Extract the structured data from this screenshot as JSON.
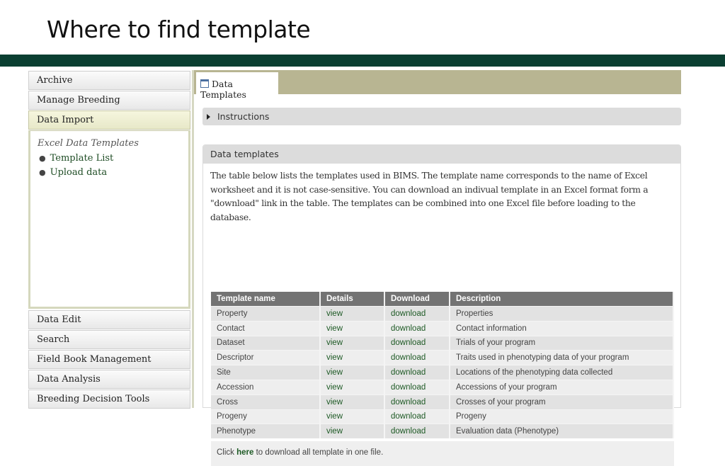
{
  "slide": {
    "title": "Where to find template"
  },
  "sidebar": {
    "items_top": [
      {
        "label": "Archive"
      },
      {
        "label": "Manage Breeding"
      },
      {
        "label": "Data Import",
        "active": true
      }
    ],
    "submenu": {
      "heading": "Excel Data Templates",
      "links": [
        {
          "label": "Template List"
        },
        {
          "label": "Upload data"
        }
      ]
    },
    "items_bottom": [
      {
        "label": "Data Edit"
      },
      {
        "label": "Search"
      },
      {
        "label": "Field Book Management"
      },
      {
        "label": "Data Analysis"
      },
      {
        "label": "Breeding Decision Tools"
      }
    ]
  },
  "main": {
    "tab": {
      "label": "Data Templates",
      "icon": "window-icon"
    },
    "instructions": {
      "label": "Instructions",
      "icon": "caret-right-icon"
    },
    "panel": {
      "title": "Data templates",
      "description": "The table below lists the templates used in BIMS. The template name corresponds to the name of Excel worksheet and it is not case-sensitive. You can download an indivual template in an Excel format form a \"download\" link in the table. The templates can be combined into one Excel file before loading to the database."
    },
    "table": {
      "headers": [
        "Template name",
        "Details",
        "Download",
        "Description"
      ],
      "rows": [
        {
          "name": "Property",
          "details": "view",
          "download": "download",
          "description": "Properties"
        },
        {
          "name": "Contact",
          "details": "view",
          "download": "download",
          "description": "Contact information"
        },
        {
          "name": "Dataset",
          "details": "view",
          "download": "download",
          "description": "Trials of your program"
        },
        {
          "name": "Descriptor",
          "details": "view",
          "download": "download",
          "description": "Traits used in phenotyping data of your program"
        },
        {
          "name": "Site",
          "details": "view",
          "download": "download",
          "description": "Locations of the phenotyping data collected"
        },
        {
          "name": "Accession",
          "details": "view",
          "download": "download",
          "description": "Accessions of your program"
        },
        {
          "name": "Cross",
          "details": "view",
          "download": "download",
          "description": "Crosses of your program"
        },
        {
          "name": "Progeny",
          "details": "view",
          "download": "download",
          "description": "Progeny"
        },
        {
          "name": "Phenotype",
          "details": "view",
          "download": "download",
          "description": "Evaluation data (Phenotype)"
        }
      ],
      "footer": {
        "prefix": "Click ",
        "link": "here",
        "suffix": " to download all template in one file."
      }
    }
  },
  "colors": {
    "band": "#0b3f31",
    "tabbar": "#b8b592",
    "link": "#1e5a25",
    "table_header": "#737373"
  }
}
